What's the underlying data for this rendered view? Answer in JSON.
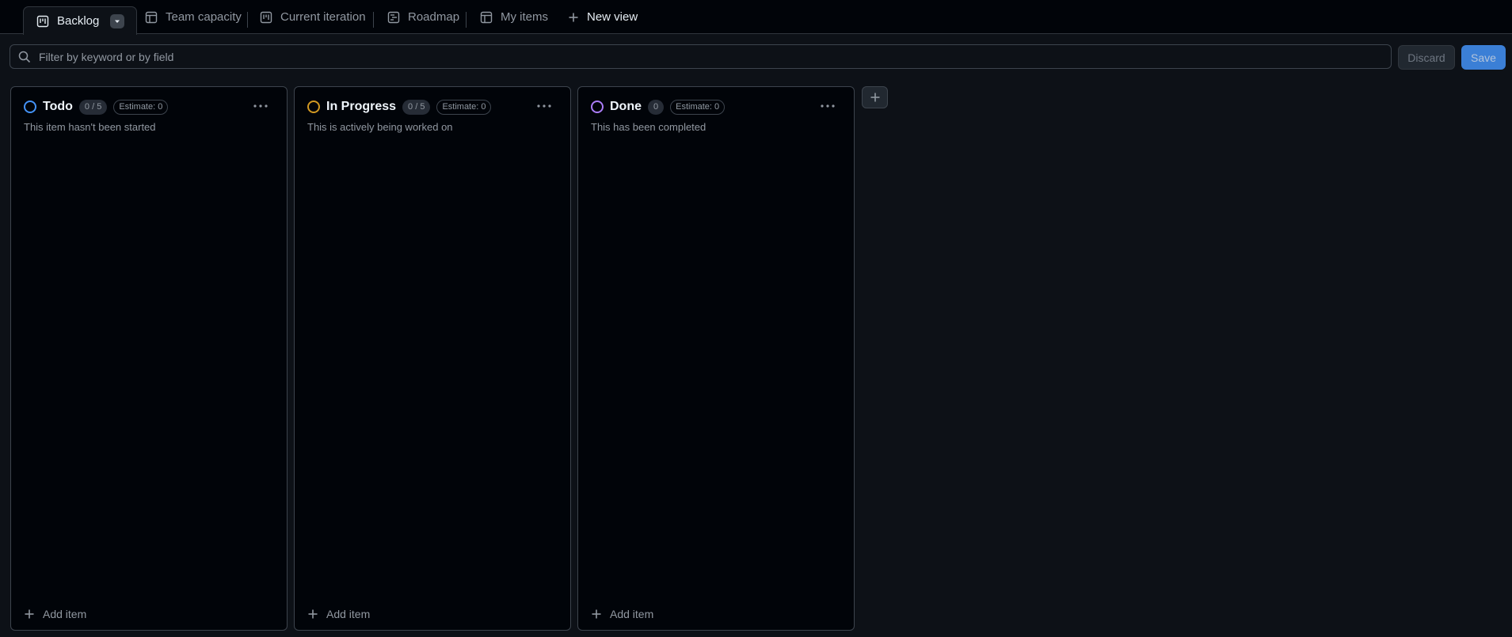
{
  "tabs": {
    "backlog": "Backlog",
    "team_capacity": "Team capacity",
    "current_iteration": "Current iteration",
    "roadmap": "Roadmap",
    "my_items": "My items",
    "new_view": "New view"
  },
  "filter": {
    "placeholder": "Filter by keyword or by field"
  },
  "actions": {
    "discard": "Discard",
    "save": "Save"
  },
  "columns": [
    {
      "title": "Todo",
      "count": "0 / 5",
      "estimate": "Estimate: 0",
      "description": "This item hasn't been started",
      "add_item": "Add item",
      "status_color": "#4493f8"
    },
    {
      "title": "In Progress",
      "count": "0 / 5",
      "estimate": "Estimate: 0",
      "description": "This is actively being worked on",
      "add_item": "Add item",
      "status_color": "#d29922"
    },
    {
      "title": "Done",
      "count": "0",
      "estimate": "Estimate: 0",
      "description": "This has been completed",
      "add_item": "Add item",
      "status_color": "#ab7df8"
    }
  ]
}
